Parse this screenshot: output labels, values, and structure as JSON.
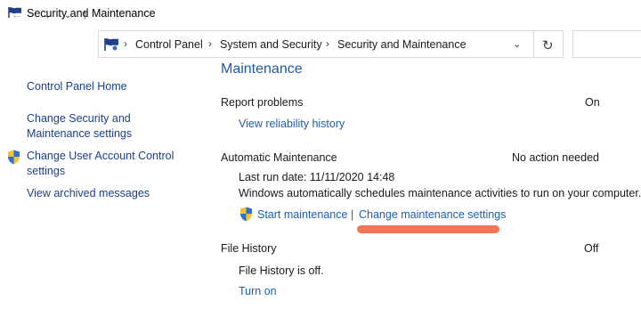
{
  "window": {
    "title": "Security and Maintenance"
  },
  "nav": {
    "back": "←",
    "forward": "→",
    "recent": "⌄",
    "up": "↑",
    "refresh": "↻",
    "dropdown": "⌄"
  },
  "address": {
    "crumbs": [
      "Control Panel",
      "System and Security",
      "Security and Maintenance"
    ],
    "separator": "›"
  },
  "sidebar": {
    "items": [
      {
        "label": "Control Panel Home"
      },
      {
        "label_line1": "Change Security and",
        "label_line2": "Maintenance settings"
      },
      {
        "label_line1": "Change User Account Control",
        "label_line2": "settings",
        "icon": "uac-shield-icon"
      },
      {
        "label": "View archived messages"
      }
    ]
  },
  "main": {
    "section_title": "Maintenance",
    "report_problems": {
      "label": "Report problems",
      "status": "On",
      "link": "View reliability history"
    },
    "automatic_maintenance": {
      "label": "Automatic Maintenance",
      "status": "No action needed",
      "last_run": "Last run date: 11/11/2020 14:48",
      "description": "Windows automatically schedules maintenance activities to run on your computer.",
      "start_link": "Start maintenance",
      "divider": "|",
      "settings_link": "Change maintenance settings"
    },
    "file_history": {
      "label": "File History",
      "status": "Off",
      "description": "File History is off.",
      "link": "Turn on"
    }
  },
  "colors": {
    "link": "#1a5fb4",
    "heading": "#1e5aa8",
    "highlight": "#f26a4b"
  }
}
